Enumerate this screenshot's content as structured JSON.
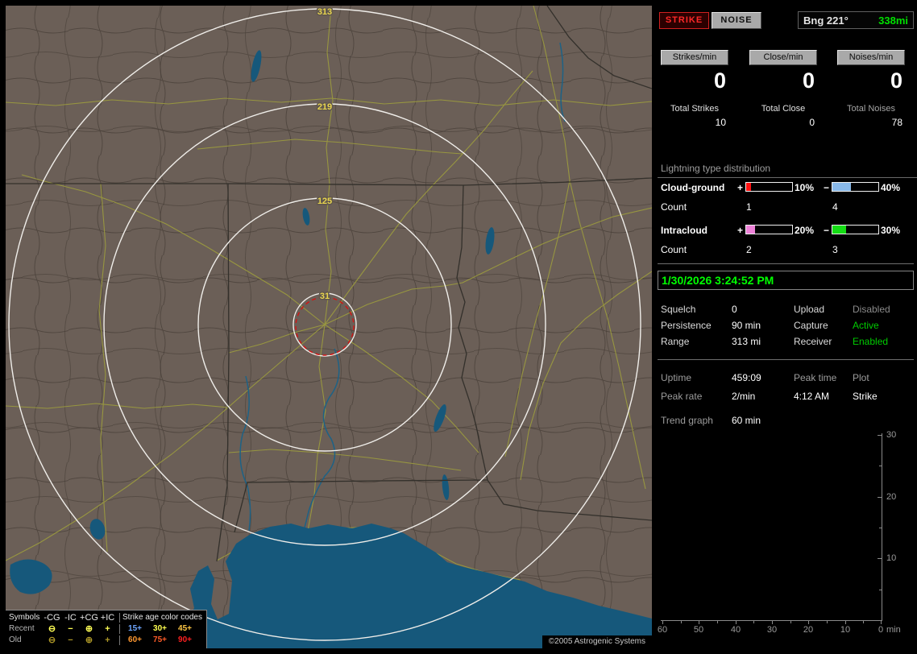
{
  "map": {
    "rings": [
      "313",
      "219",
      "125",
      "31"
    ],
    "copyright": "©2005 Astrogenic Systems",
    "legend": {
      "symbols_title": "Symbols",
      "col_headers": [
        "-CG",
        "-IC",
        "+CG",
        "+IC"
      ],
      "age_title": "Strike age color codes",
      "rows": [
        {
          "label": "Recent",
          "symbols": [
            "⊖",
            "−",
            "⊕",
            "+"
          ],
          "ages": [
            "15+",
            "30+",
            "45+"
          ]
        },
        {
          "label": "Old",
          "symbols": [
            "⊖",
            "−",
            "⊕",
            "+"
          ],
          "ages": [
            "60+",
            "75+",
            "90+"
          ]
        }
      ]
    }
  },
  "sidebar": {
    "strike_lamp": "STRIKE",
    "noise_lamp": "NOISE",
    "bearing": {
      "label": "Bng 221°",
      "distance": "338mi"
    },
    "rates": [
      {
        "label": "Strikes/min",
        "value": "0"
      },
      {
        "label": "Close/min",
        "value": "0"
      },
      {
        "label": "Noises/min",
        "value": "0"
      }
    ],
    "totals": [
      {
        "label": "Total Strikes",
        "value": "10"
      },
      {
        "label": "Total Close",
        "value": "0"
      },
      {
        "label": "Total Noises",
        "value": "78"
      }
    ],
    "distribution": {
      "title": "Lightning type distribution",
      "rows": [
        {
          "label": "Cloud-ground",
          "plus_sign": "+",
          "plus_pct": "10%",
          "plus_fill": "10%",
          "plus_color": "#ff1010",
          "minus_sign": "−",
          "minus_pct": "40%",
          "minus_fill": "40%",
          "minus_color": "#88b8e8",
          "count_label": "Count",
          "plus_count": "1",
          "minus_count": "4"
        },
        {
          "label": "Intracloud",
          "plus_sign": "+",
          "plus_pct": "20%",
          "plus_fill": "20%",
          "plus_color": "#ee82d8",
          "minus_sign": "−",
          "minus_pct": "30%",
          "minus_fill": "30%",
          "minus_color": "#15dd15",
          "count_label": "Count",
          "plus_count": "2",
          "minus_count": "3"
        }
      ]
    },
    "datetime": "1/30/2026 3:24:52 PM",
    "settings": [
      {
        "label_l": "Squelch",
        "value_l": "0",
        "label_r": "Upload",
        "value_r": "Disabled"
      },
      {
        "label_l": "Persistence",
        "value_l": "90 min",
        "label_r": "Capture",
        "value_r": "Active"
      },
      {
        "label_l": "Range",
        "value_l": "313 mi",
        "label_r": "Receiver",
        "value_r": "Enabled"
      }
    ],
    "status": {
      "rows": [
        {
          "c1": "Uptime",
          "c2": "459:09",
          "c3": "Peak time",
          "c4": "Plot"
        },
        {
          "c1": "Peak rate",
          "c2": "2/min",
          "c3": "4:12 AM",
          "c4": "Strike"
        }
      ],
      "trend_label": "Trend graph",
      "trend_value": "60 min"
    },
    "trend": {
      "y_labels": [
        "30",
        "20",
        "10"
      ],
      "x_labels": [
        "60",
        "50",
        "40",
        "30",
        "20",
        "10",
        "0"
      ],
      "x_unit": "min"
    },
    "colors": {
      "strike_lamp_red": "#ff2828",
      "bearing_green": "#00e000",
      "datetime_green": "#00ff00",
      "active_green": "#00cc00",
      "disabled_gray": "#8a8a8a"
    }
  }
}
